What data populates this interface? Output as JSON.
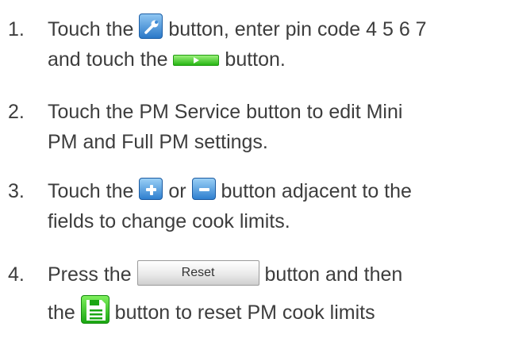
{
  "steps": [
    {
      "number": "1.",
      "text_a": "Touch the",
      "text_b": "button, enter pin code 4 5 6 7",
      "text_c": "and touch the",
      "text_d": "button."
    },
    {
      "number": "2.",
      "line1": "Touch the PM Service button to edit Mini",
      "line2": "PM and Full PM settings."
    },
    {
      "number": "3.",
      "text_a": "Touch the",
      "text_or": "or",
      "text_b": "button adjacent to the",
      "text_c": "fields to change cook limits."
    },
    {
      "number": "4.",
      "text_a": "Press the",
      "reset_label": "Reset",
      "text_b": "button and then",
      "text_c": "the",
      "text_d": "button to reset PM cook limits"
    }
  ],
  "icons": {
    "wrench": "wrench-icon",
    "arrow": "play-arrow-icon",
    "plus": "plus-icon",
    "minus": "minus-icon",
    "save": "save-icon"
  },
  "colors": {
    "text": "#3d3d3d",
    "blue_button": "#2a78c8",
    "green_button": "#27b614"
  }
}
